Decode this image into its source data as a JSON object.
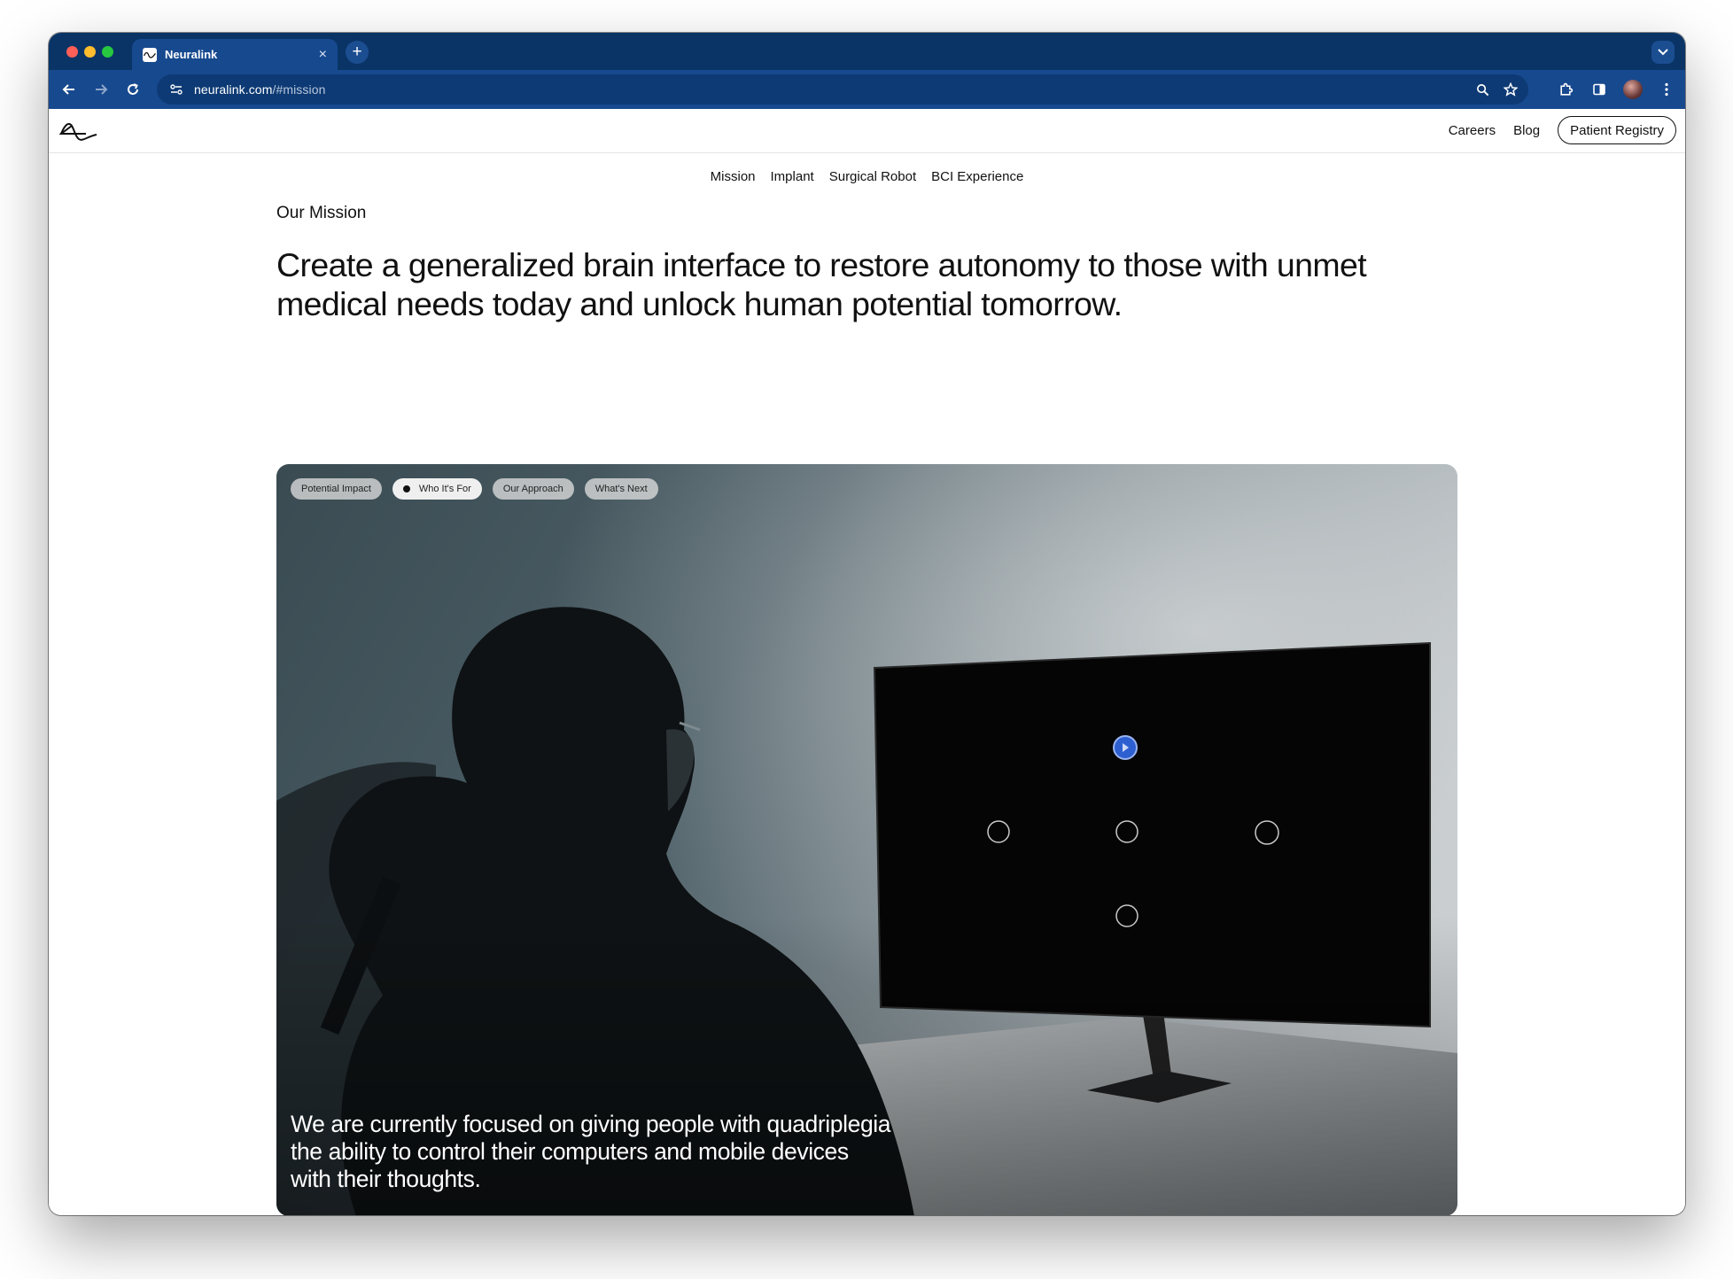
{
  "browser": {
    "tab_title": "Neuralink",
    "url_host": "neuralink.com",
    "url_path": "/#mission"
  },
  "header": {
    "links": [
      "Careers",
      "Blog"
    ],
    "cta_label": "Patient Registry"
  },
  "subnav": {
    "items": [
      "Mission",
      "Implant",
      "Surgical Robot",
      "BCI Experience"
    ]
  },
  "mission": {
    "eyebrow": "Our Mission",
    "headline": "Create a generalized brain interface to restore autonomy to those with unmet medical needs today and unlock human potential tomorrow."
  },
  "hero": {
    "chips": [
      "Potential Impact",
      "Who It's For",
      "Our Approach",
      "What's Next"
    ],
    "active_chip": "Who It's For",
    "caption": "We are currently focused on giving people with quadriplegia the ability to control their computers and mobile devices with their thoughts."
  },
  "colors": {
    "chrome_dark": "#0a3466",
    "chrome": "#17498f",
    "cursor_target": "#2d5fd1"
  }
}
